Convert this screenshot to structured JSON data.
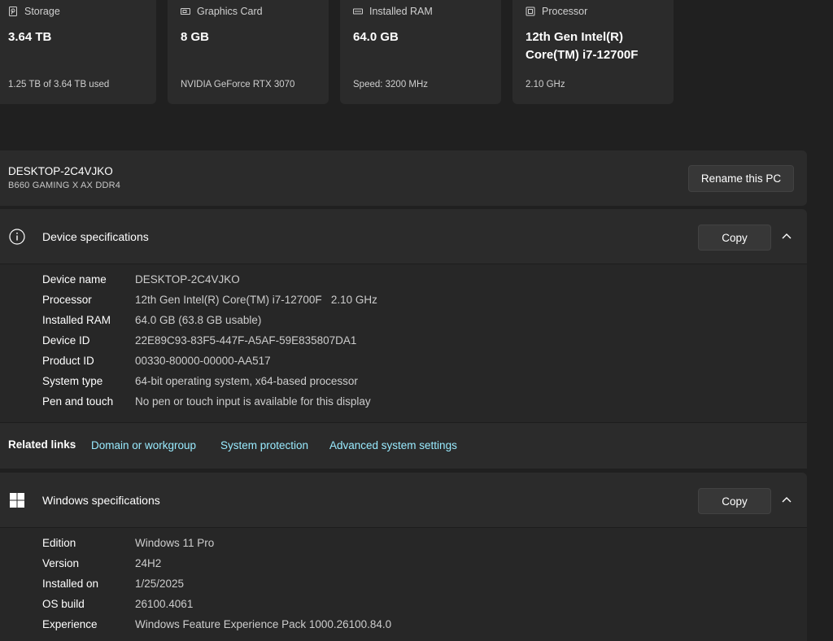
{
  "cards": [
    {
      "title": "Storage",
      "icon": "storage-icon",
      "value": "3.64 TB",
      "sub": "1.25 TB of 3.64 TB used"
    },
    {
      "title": "Graphics Card",
      "icon": "graphics-card-icon",
      "value": "8 GB",
      "sub": "NVIDIA GeForce RTX 3070"
    },
    {
      "title": "Installed RAM",
      "icon": "ram-icon",
      "value": "64.0 GB",
      "sub": "Speed: 3200 MHz"
    },
    {
      "title": "Processor",
      "icon": "processor-icon",
      "value_line1": "12th Gen Intel(R)",
      "value_line2": "Core(TM) i7-12700F",
      "sub": "2.10 GHz"
    }
  ],
  "pc": {
    "name": "DESKTOP-2C4VJKO",
    "model": "B660 GAMING X AX DDR4",
    "rename_label": "Rename this PC"
  },
  "device_specs": {
    "title": "Device specifications",
    "copy_label": "Copy",
    "rows": [
      {
        "key": "Device name",
        "value": "DESKTOP-2C4VJKO"
      },
      {
        "key": "Processor",
        "value": "12th Gen Intel(R) Core(TM) i7-12700F   2.10 GHz"
      },
      {
        "key": "Installed RAM",
        "value": "64.0 GB (63.8 GB usable)"
      },
      {
        "key": "Device ID",
        "value": "22E89C93-83F5-447F-A5AF-59E835807DA1"
      },
      {
        "key": "Product ID",
        "value": "00330-80000-00000-AA517"
      },
      {
        "key": "System type",
        "value": "64-bit operating system, x64-based processor"
      },
      {
        "key": "Pen and touch",
        "value": "No pen or touch input is available for this display"
      }
    ]
  },
  "related_links": {
    "label": "Related links",
    "links": [
      "Domain or workgroup",
      "System protection",
      "Advanced system settings"
    ]
  },
  "windows_specs": {
    "title": "Windows specifications",
    "copy_label": "Copy",
    "rows": [
      {
        "key": "Edition",
        "value": "Windows 11 Pro"
      },
      {
        "key": "Version",
        "value": "24H2"
      },
      {
        "key": "Installed on",
        "value": "1/25/2025"
      },
      {
        "key": "OS build",
        "value": "26100.4061"
      },
      {
        "key": "Experience",
        "value": "Windows Feature Experience Pack 1000.26100.84.0"
      }
    ]
  },
  "colors": {
    "background": "#202020",
    "card": "#2b2b2b",
    "link": "#99ebff"
  }
}
